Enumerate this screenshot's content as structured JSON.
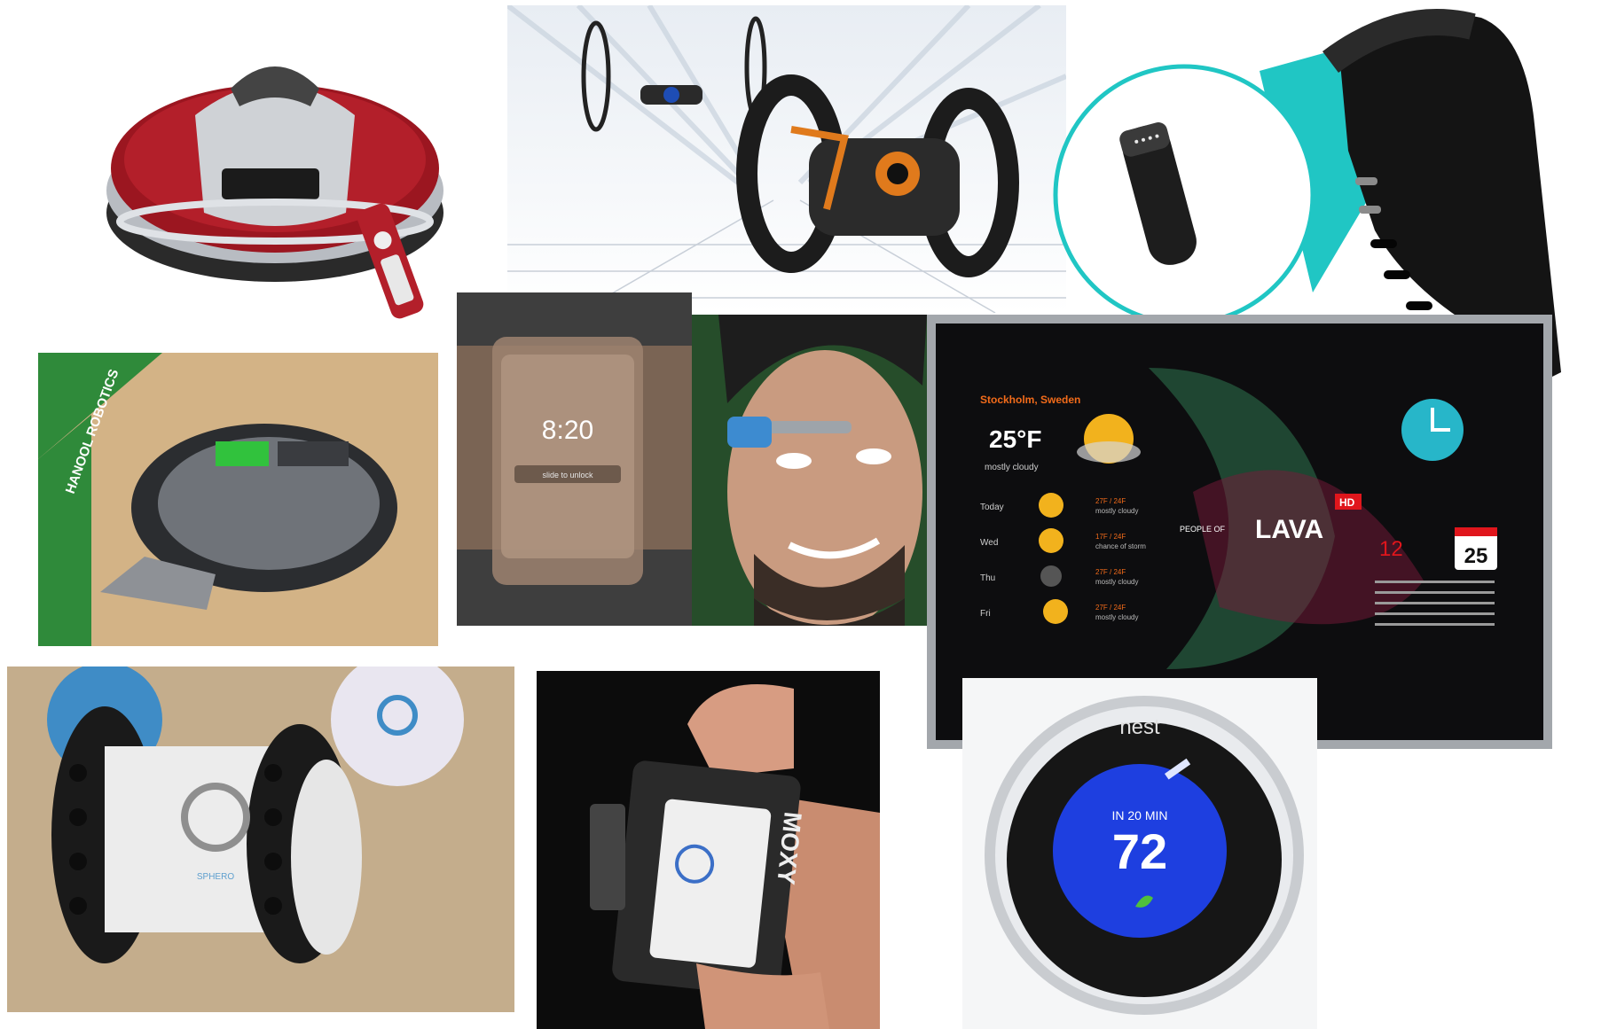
{
  "tablet": {
    "city": "Stockholm, Sweden",
    "temp": "25°F",
    "condition": "mostly cloudy",
    "forecast": [
      {
        "day": "Today",
        "temps": "27F / 24F",
        "cond": "mostly cloudy"
      },
      {
        "day": "Wed",
        "temps": "17F / 24F",
        "cond": "chance of storm"
      },
      {
        "day": "Thu",
        "temps": "27F / 24F",
        "cond": "mostly cloudy"
      },
      {
        "day": "Fri",
        "temps": "27F / 24F",
        "cond": "mostly cloudy"
      }
    ],
    "brand_small": "PEOPLE OF",
    "brand_main": "LAVA",
    "brand_hd": "HD",
    "date_num": "12",
    "calendar_day": "25"
  },
  "watch": {
    "time": "8:20",
    "unlock": "slide to unlock"
  },
  "nest": {
    "brand": "nest",
    "status": "IN 20 MIN",
    "temp": "72"
  },
  "mini_robot": {
    "label": "HANOOL ROBOTICS"
  },
  "moxy": {
    "label": "MOXY"
  },
  "ollie": {
    "label": "SPHERO"
  },
  "colors": {
    "fitbit_accent": "#20c6c4",
    "nest_blue": "#1e3fe0",
    "vacuum_red": "#9b1620",
    "drone_orange": "#e07a1c"
  }
}
